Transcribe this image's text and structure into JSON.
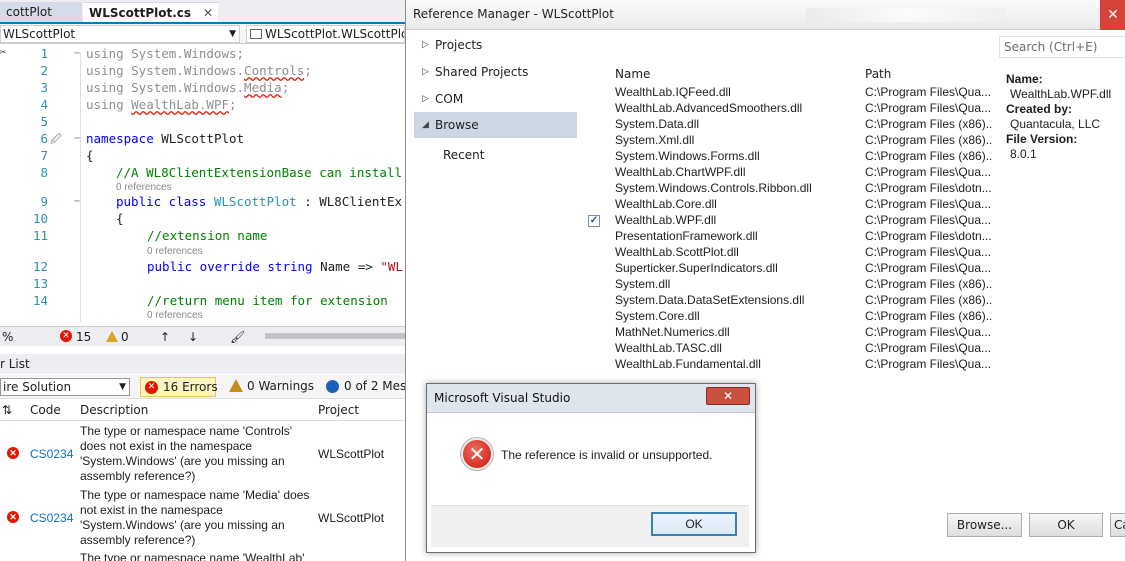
{
  "editor": {
    "tabs": [
      {
        "label": "cottPlot"
      },
      {
        "label": "WLScottPlot.cs",
        "close": "✕"
      }
    ],
    "nav_left": "WLScottPlot",
    "nav_right": "WLScottPlot.WLScottPlot",
    "lines": [
      {
        "num": "1",
        "parts": [
          {
            "t": "using System.Windows;",
            "c": "gr"
          }
        ]
      },
      {
        "num": "2",
        "parts": [
          {
            "t": "using System.Windows.Controls;",
            "c": "gr"
          }
        ]
      },
      {
        "num": "3",
        "parts": [
          {
            "t": "using System.Windows.Media;",
            "c": "gr"
          }
        ]
      },
      {
        "num": "4",
        "parts": [
          {
            "t": "using WealthLab.WPF;",
            "c": "gr"
          }
        ]
      },
      {
        "num": "5",
        "parts": []
      },
      {
        "num": "6",
        "parts": [
          {
            "t": "namespace ",
            "c": "kw"
          },
          {
            "t": "WLScottPlot",
            "c": ""
          }
        ]
      },
      {
        "num": "7",
        "parts": [
          {
            "t": "{",
            "c": ""
          }
        ]
      },
      {
        "num": "8",
        "parts": [
          {
            "t": "//A WL8ClientExtensionBase can install",
            "c": "cm"
          }
        ]
      },
      {
        "num": "9",
        "parts": [
          {
            "t": "public class ",
            "c": "kw"
          },
          {
            "t": "WLScottPlot",
            "c": "ty"
          },
          {
            "t": " : ",
            "c": ""
          },
          {
            "t": "WL8ClientEx",
            "c": ""
          }
        ]
      },
      {
        "num": "10",
        "parts": [
          {
            "t": "{",
            "c": ""
          }
        ]
      },
      {
        "num": "11",
        "parts": [
          {
            "t": "//extension name",
            "c": "cm"
          }
        ]
      },
      {
        "num": "12",
        "parts": [
          {
            "t": "public override string ",
            "c": "kw"
          },
          {
            "t": "Name => ",
            "c": ""
          },
          {
            "t": "\"WL",
            "c": "str"
          }
        ]
      },
      {
        "num": "13",
        "parts": []
      },
      {
        "num": "14",
        "parts": [
          {
            "t": "//return menu item for extension",
            "c": "cm"
          }
        ]
      }
    ],
    "ref_label": "0 references",
    "status": {
      "zoom": "%",
      "errors": "15",
      "warnings": "0"
    }
  },
  "error_list": {
    "title": "r List",
    "scope": "ire Solution",
    "filters": {
      "errors": "16 Errors",
      "warnings": "0 Warnings",
      "messages": "0 of 2 Mess"
    },
    "columns": {
      "code": "Code",
      "description": "Description",
      "project": "Project"
    },
    "rows": [
      {
        "code": "CS0234",
        "description": "The type or namespace name 'Controls' does not exist in the namespace 'System.Windows' (are you missing an assembly reference?)",
        "project": "WLScottPlot"
      },
      {
        "code": "CS0234",
        "description": "The type or namespace name 'Media' does not exist in the namespace 'System.Windows' (are you missing an assembly reference?)",
        "project": "WLScottPlot"
      },
      {
        "code": "",
        "description": "The type or namespace name 'WealthLab'",
        "project": ""
      }
    ]
  },
  "reference_manager": {
    "title": "Reference Manager - WLScottPlot",
    "close": "✕",
    "nav": [
      {
        "label": "Projects",
        "chev": "▷"
      },
      {
        "label": "Shared Projects",
        "chev": "▷"
      },
      {
        "label": "COM",
        "chev": "▷"
      },
      {
        "label": "Browse",
        "chev": "◢"
      },
      {
        "label": "Recent",
        "chev": ""
      }
    ],
    "search_placeholder": "Search (Ctrl+E)",
    "columns": {
      "name": "Name",
      "path": "Path"
    },
    "rows": [
      {
        "name": "WealthLab.IQFeed.dll",
        "path": "C:\\Program Files\\Qua...",
        "checked": false
      },
      {
        "name": "WealthLab.AdvancedSmoothers.dll",
        "path": "C:\\Program Files\\Qua...",
        "checked": false
      },
      {
        "name": "System.Data.dll",
        "path": "C:\\Program Files (x86)...",
        "checked": false
      },
      {
        "name": "System.Xml.dll",
        "path": "C:\\Program Files (x86)...",
        "checked": false
      },
      {
        "name": "System.Windows.Forms.dll",
        "path": "C:\\Program Files (x86)...",
        "checked": false
      },
      {
        "name": "WealthLab.ChartWPF.dll",
        "path": "C:\\Program Files\\Qua...",
        "checked": false
      },
      {
        "name": "System.Windows.Controls.Ribbon.dll",
        "path": "C:\\Program Files\\dotn...",
        "checked": false
      },
      {
        "name": "WealthLab.Core.dll",
        "path": "C:\\Program Files\\Qua...",
        "checked": false
      },
      {
        "name": "WealthLab.WPF.dll",
        "path": "C:\\Program Files\\Qua...",
        "checked": true
      },
      {
        "name": "PresentationFramework.dll",
        "path": "C:\\Program Files\\dotn...",
        "checked": false
      },
      {
        "name": "WealthLab.ScottPlot.dll",
        "path": "C:\\Program Files\\Qua...",
        "checked": false
      },
      {
        "name": "Superticker.SuperIndicators.dll",
        "path": "C:\\Program Files\\Qua...",
        "checked": false
      },
      {
        "name": "System.dll",
        "path": "C:\\Program Files (x86)...",
        "checked": false
      },
      {
        "name": "System.Data.DataSetExtensions.dll",
        "path": "C:\\Program Files (x86)...",
        "checked": false
      },
      {
        "name": "System.Core.dll",
        "path": "C:\\Program Files (x86)...",
        "checked": false
      },
      {
        "name": "MathNet.Numerics.dll",
        "path": "C:\\Program Files\\Qua...",
        "checked": false
      },
      {
        "name": "WealthLab.TASC.dll",
        "path": "C:\\Program Files\\Qua...",
        "checked": false
      },
      {
        "name": "WealthLab.Fundamental.dll",
        "path": "C:\\Program Files\\Qua...",
        "checked": false
      }
    ],
    "details": {
      "name_label": "Name:",
      "name_value": "WealthLab.WPF.dll",
      "created_label": "Created by:",
      "created_value": "Quantacula, LLC",
      "version_label": "File Version:",
      "version_value": "8.0.1"
    },
    "buttons": {
      "browse": "Browse...",
      "ok": "OK",
      "cancel": "Ca"
    }
  },
  "message_box": {
    "title": "Microsoft Visual Studio",
    "close": "✕",
    "message": "The reference is invalid or unsupported.",
    "ok": "OK",
    "icon": "error-icon"
  }
}
